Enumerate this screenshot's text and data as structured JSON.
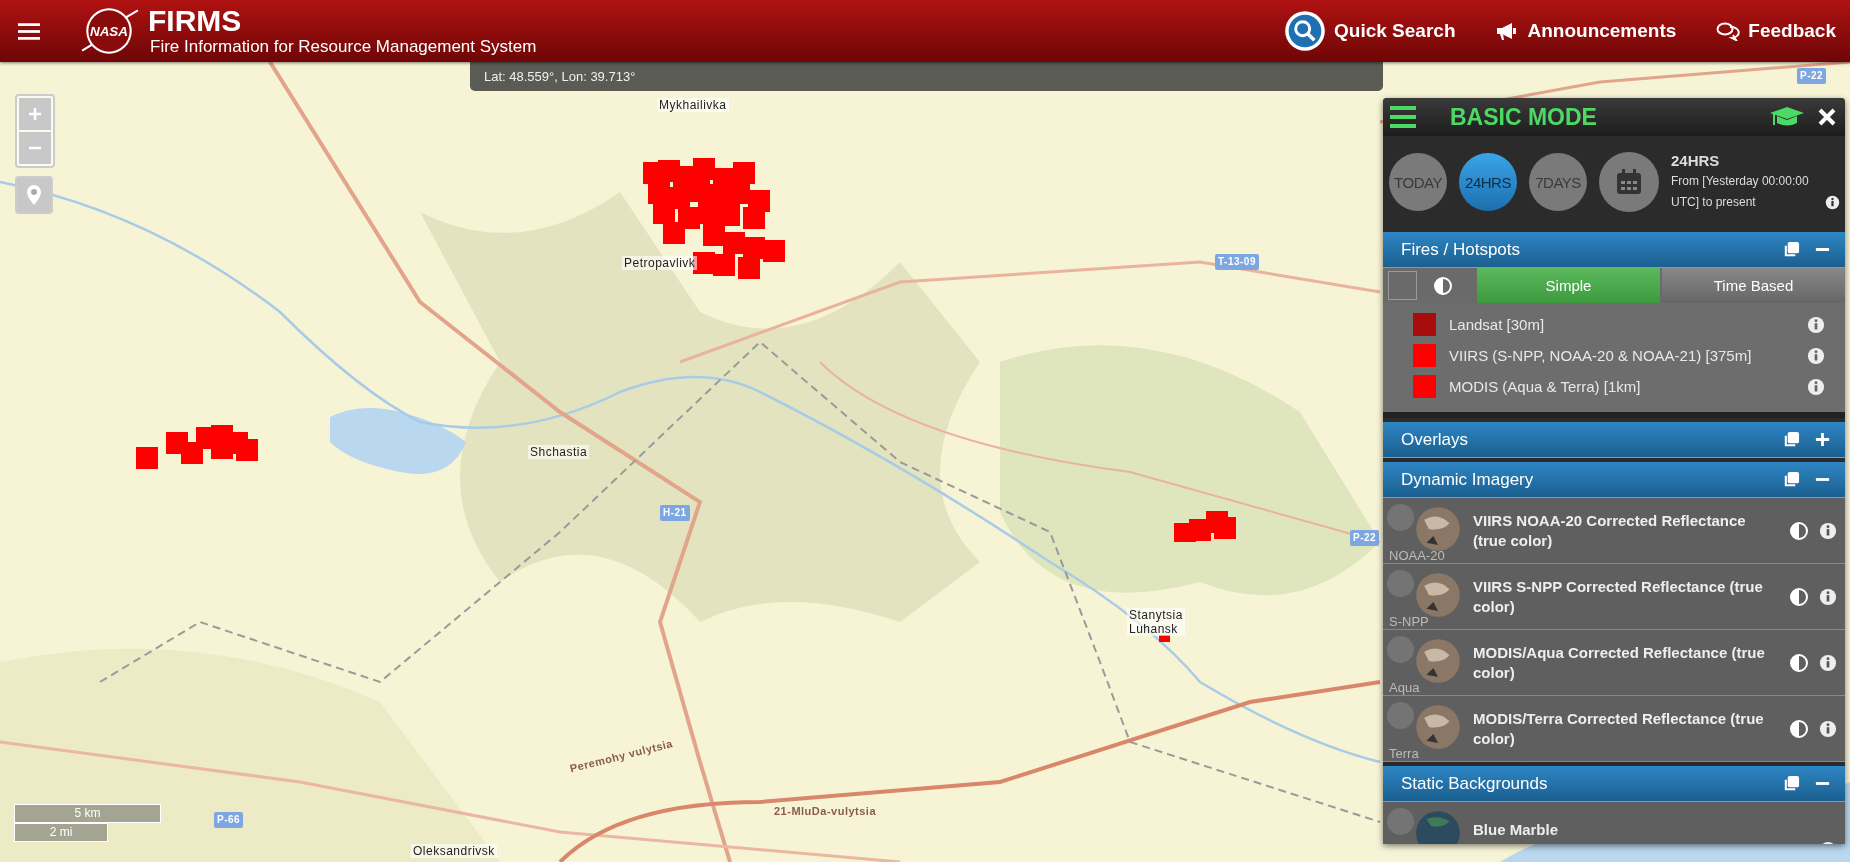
{
  "header": {
    "logo": "NASA",
    "title": "FIRMS",
    "subtitle": "Fire Information for Resource Management System",
    "nav": [
      {
        "kind": "search",
        "label": "Quick Search"
      },
      {
        "kind": "announce",
        "label": "Announcements"
      },
      {
        "kind": "feedback",
        "label": "Feedback"
      }
    ]
  },
  "coordinates": "Lat: 48.559°, Lon: 39.713°",
  "map": {
    "labels": [
      {
        "kind": "place",
        "text": "Mykhailivka"
      },
      {
        "kind": "place",
        "text": "Petropavlivk"
      },
      {
        "kind": "place",
        "text": "Shchastia"
      },
      {
        "kind": "place",
        "text": "Stanytsia\nLuhansk"
      },
      {
        "kind": "place",
        "text": "Oleksandrivsk"
      },
      {
        "kind": "road",
        "text": "T-13-09"
      },
      {
        "kind": "road",
        "text": "H-21"
      },
      {
        "kind": "road",
        "text": "P-22"
      },
      {
        "kind": "road",
        "text": "P-22"
      },
      {
        "kind": "road",
        "text": "P-66"
      },
      {
        "kind": "street",
        "text": "Peremohy vulytsia"
      },
      {
        "kind": "street",
        "text": "21-MluDa-vulytsia"
      }
    ],
    "scale": [
      "5 km",
      "2 mi"
    ]
  },
  "panel": {
    "title": "BASIC MODE",
    "periods": [
      {
        "label": "TODAY",
        "selected": false
      },
      {
        "label": "24HRS",
        "selected": true
      },
      {
        "label": "7DAYS",
        "selected": false
      }
    ],
    "range_title": "24HRS",
    "range_text": "From [Yesterday 00:00:00 UTC] to present",
    "sections": [
      {
        "kind": "fires",
        "title": "Fires / Hotspots",
        "expanded": true,
        "all_checked": false,
        "modes": [
          {
            "label": "Simple",
            "selected": true
          },
          {
            "label": "Time Based",
            "selected": false
          }
        ],
        "legend": [
          {
            "label": "Landsat [30m]",
            "color": "#a80d0d"
          },
          {
            "label": "VIIRS (S-NPP, NOAA-20 & NOAA-21) [375m]",
            "color": "#ff0000"
          },
          {
            "label": "MODIS (Aqua & Terra) [1km]",
            "color": "#ff0000"
          }
        ]
      },
      {
        "title": "Overlays",
        "expanded": false
      },
      {
        "kind": "imagery",
        "title": "Dynamic Imagery",
        "expanded": true,
        "layers": [
          {
            "title": "VIIRS NOAA-20 Corrected Reflectance (true color)",
            "thumb": "NOAA-20",
            "checked": false
          },
          {
            "title": "VIIRS S-NPP Corrected Reflectance (true color)",
            "thumb": "S-NPP",
            "checked": false
          },
          {
            "title": "MODIS/Aqua Corrected Reflectance (true color)",
            "thumb": "Aqua",
            "checked": false
          },
          {
            "title": "MODIS/Terra Corrected Reflectance (true color)",
            "thumb": "Terra",
            "checked": false
          }
        ]
      },
      {
        "kind": "backgrounds",
        "title": "Static Backgrounds",
        "expanded": true,
        "layers": [
          {
            "title": "Blue Marble",
            "checked": false
          }
        ]
      }
    ]
  }
}
